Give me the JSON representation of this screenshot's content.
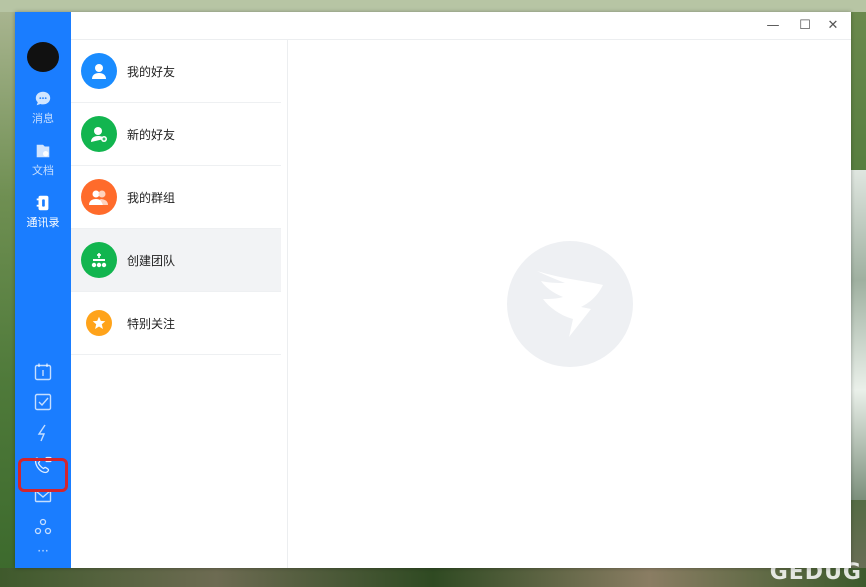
{
  "sidebar": {
    "items": [
      {
        "label": "消息",
        "icon": "chat-icon"
      },
      {
        "label": "文档",
        "icon": "docs-icon"
      },
      {
        "label": "通讯录",
        "icon": "contacts-icon"
      }
    ],
    "active": "通讯录",
    "tools": [
      "calendar-icon",
      "todo-icon",
      "ding-icon",
      "phone-icon",
      "mail-icon",
      "apps-icon",
      "more-icon"
    ],
    "more_label": "···"
  },
  "contacts": {
    "items": [
      {
        "label": "我的好友",
        "color": "#1a8cff"
      },
      {
        "label": "新的好友",
        "color": "#12b54f"
      },
      {
        "label": "我的群组",
        "color": "#ff6b2b"
      },
      {
        "label": "创建团队",
        "color": "#12b54f"
      },
      {
        "label": "特别关注",
        "color": "#ffa31a"
      }
    ],
    "selected": "创建团队"
  },
  "window_controls": {
    "minimize": "—",
    "maximize": "☐",
    "close": "✕"
  },
  "colors": {
    "accent": "#1a7dff",
    "highlight": "#d2252e"
  }
}
